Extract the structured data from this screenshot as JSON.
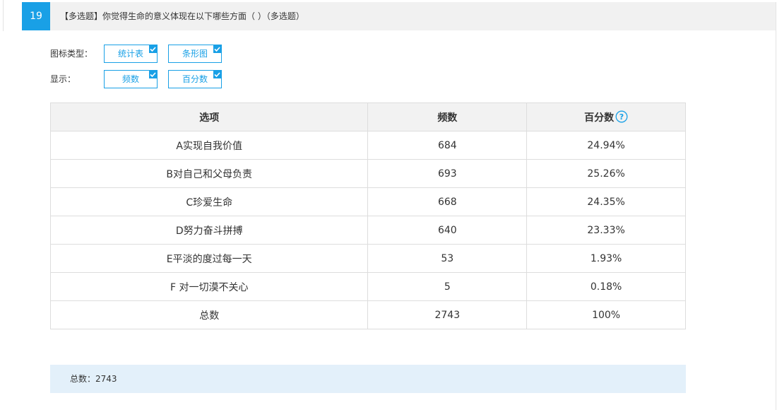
{
  "question": {
    "number": "19",
    "title": "【多选题】你觉得生命的意义体现在以下哪些方面（  ）（多选题）"
  },
  "options": {
    "chart_type_label": "图标类型：",
    "chart_type_buttons": [
      "统计表",
      "条形图"
    ],
    "display_label": "显示：",
    "display_buttons": [
      "频数",
      "百分数"
    ]
  },
  "table": {
    "headers": [
      "选项",
      "频数",
      "百分数"
    ],
    "rows": [
      [
        "A实现自我价值",
        "684",
        "24.94%"
      ],
      [
        "B对自己和父母负责",
        "693",
        "25.26%"
      ],
      [
        "C珍爱生命",
        "668",
        "24.35%"
      ],
      [
        "D努力奋斗拼搏",
        "640",
        "23.33%"
      ],
      [
        "E平淡的度过每一天",
        "53",
        "1.93%"
      ],
      [
        "F 对一切漠不关心",
        "5",
        "0.18%"
      ],
      [
        "总数",
        "2743",
        "100%"
      ]
    ]
  },
  "summary": {
    "total_text": "总数：2743"
  },
  "colors": {
    "accent": "#19a0e6",
    "header_bg": "#f1f1f1",
    "summary_bg": "#e3f0fa"
  }
}
